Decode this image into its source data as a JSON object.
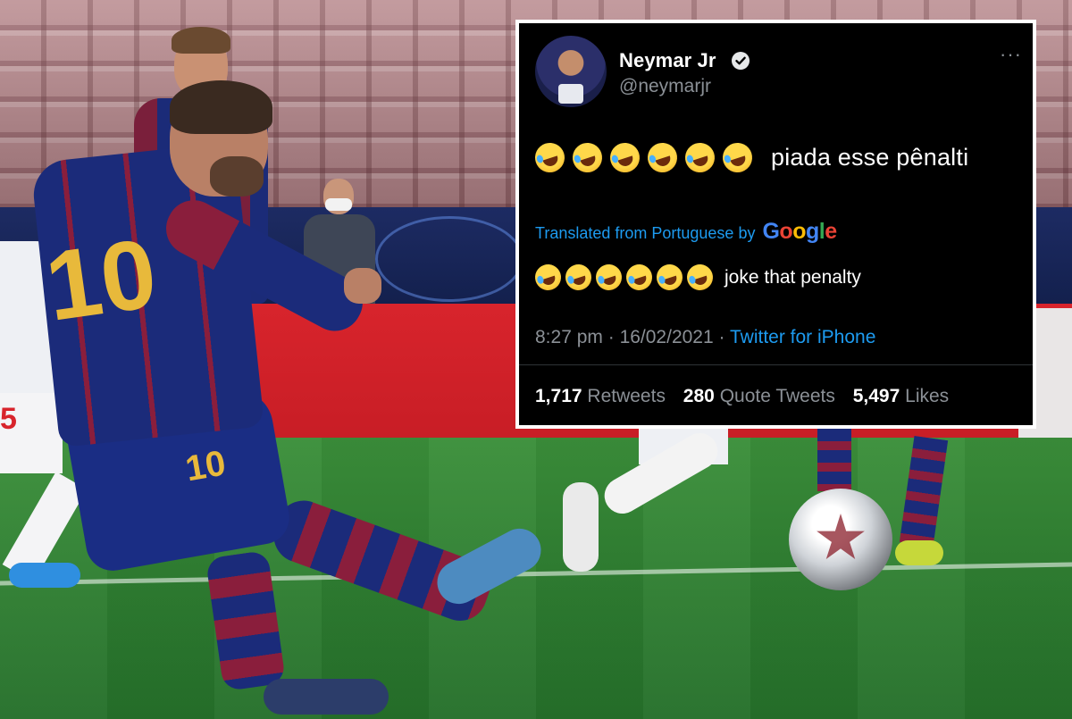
{
  "tweet": {
    "display_name": "Neymar Jr",
    "handle": "@neymarjr",
    "text": "piada esse pênalti",
    "emoji_count": 6,
    "translated_label": "Translated from Portuguese by",
    "translation_provider": "Google",
    "translation": "joke that penalty",
    "time": "8:27 pm",
    "date": "16/02/2021",
    "meta_separator": "·",
    "source": "Twitter for iPhone",
    "more_icon": "···",
    "stats": {
      "retweets_count": "1,717",
      "retweets_label": "Retweets",
      "quotes_count": "280",
      "quotes_label": "Quote Tweets",
      "likes_count": "5,497",
      "likes_label": "Likes"
    }
  },
  "photo": {
    "jersey_number": "10",
    "shorts_number": "10",
    "psg_number": "5"
  },
  "colors": {
    "tweet_background": "#000000",
    "link_blue": "#1d9bf0",
    "secondary_text": "#8b9096",
    "barca_blue": "#1b2b7a",
    "barca_red": "#8a1e3c",
    "pitch_green": "#2e7d31",
    "adboard_red": "#d8242c"
  },
  "icons": [
    "verified-badge-icon",
    "more-options-icon",
    "rolling-on-floor-laughing-emoji",
    "google-logo"
  ]
}
